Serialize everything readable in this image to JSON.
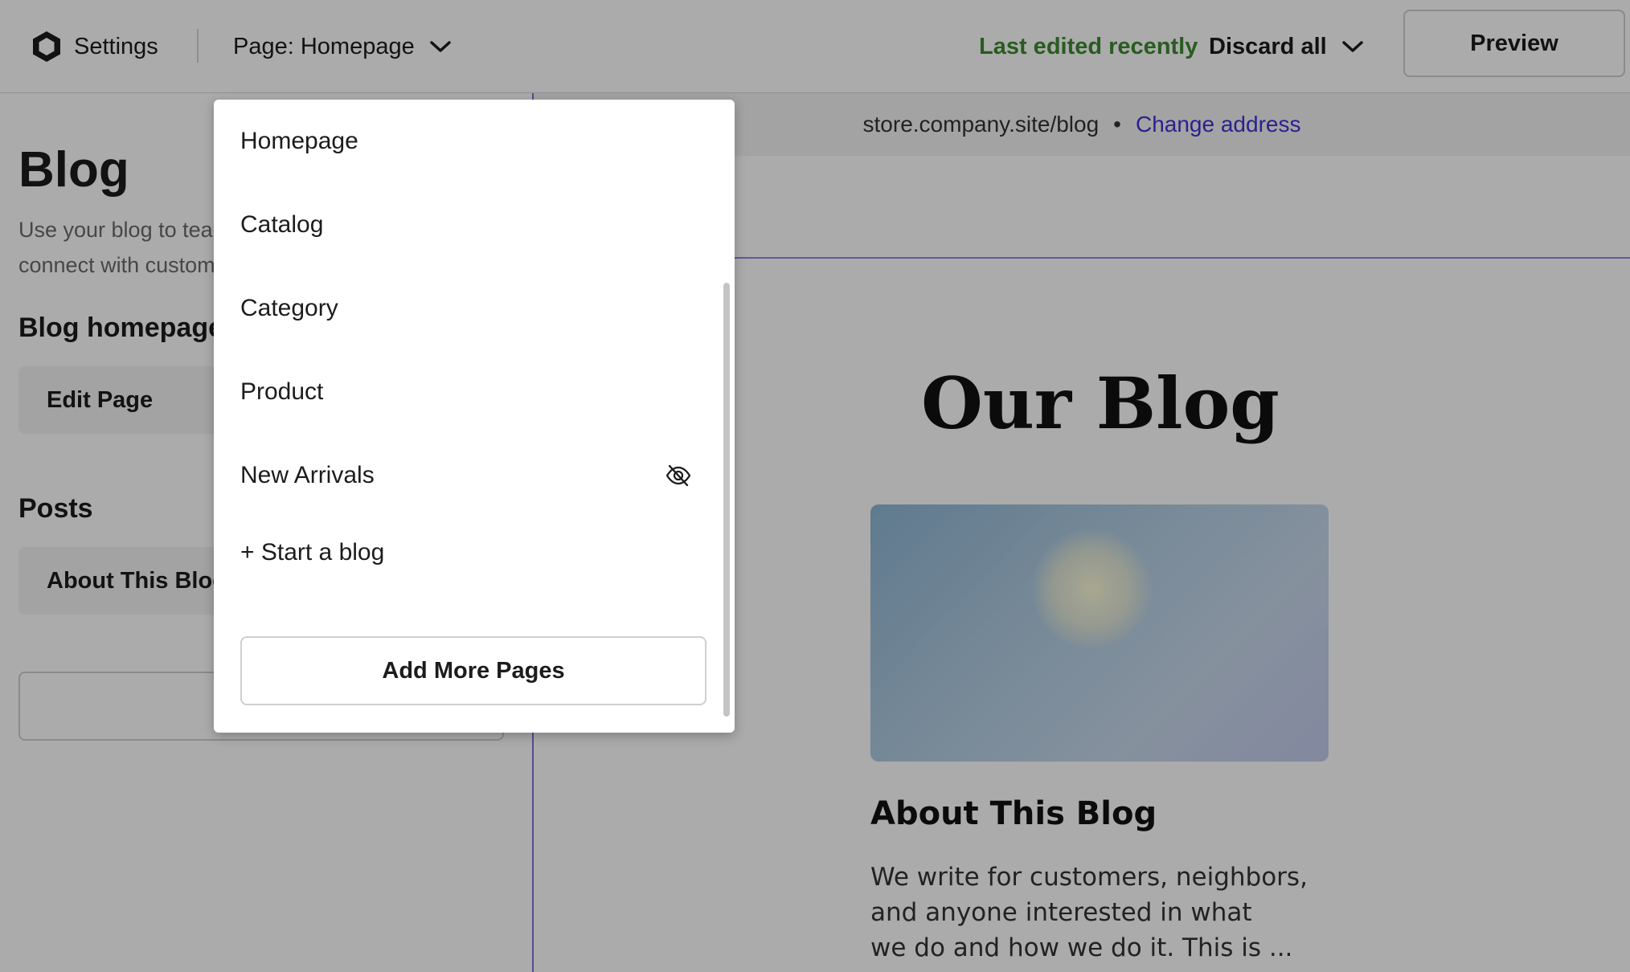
{
  "topbar": {
    "brand_label": "Settings",
    "page_select_label": "Page: Homepage",
    "status_text": "Last edited recently",
    "discard_label": "Discard all",
    "preview_label": "Preview"
  },
  "colors": {
    "status_green": "#3e8a31",
    "link_blue": "#3d33d6",
    "editor_outline": "#7b73d9"
  },
  "left_panel": {
    "title": "Blog",
    "description": "Use your blog to teach, share guidance, and connect with customers",
    "blog_homepage_heading": "Blog homepage",
    "edit_page_label": "Edit Page",
    "posts_heading": "Posts",
    "post_item_label": "About This Blog",
    "add_post_label": "+"
  },
  "preview": {
    "address": "store.company.site/blog",
    "separator": "•",
    "change_address_label": "Change address",
    "blog_title": "Our Blog",
    "post_title": "About This Blog",
    "post_excerpt_lines": [
      "We write for customers, neighbors,",
      "and anyone interested in what",
      "we do and how we do it. This is ..."
    ]
  },
  "dropdown": {
    "items": [
      {
        "label": "Homepage",
        "hidden": false
      },
      {
        "label": "Catalog",
        "hidden": false
      },
      {
        "label": "Category",
        "hidden": false
      },
      {
        "label": "Product",
        "hidden": false
      },
      {
        "label": "New Arrivals",
        "hidden": true,
        "icon": "eye-slash-icon"
      },
      {
        "label": "+ Start a blog",
        "highlighted": true
      }
    ],
    "add_more_label": "Add More Pages"
  }
}
